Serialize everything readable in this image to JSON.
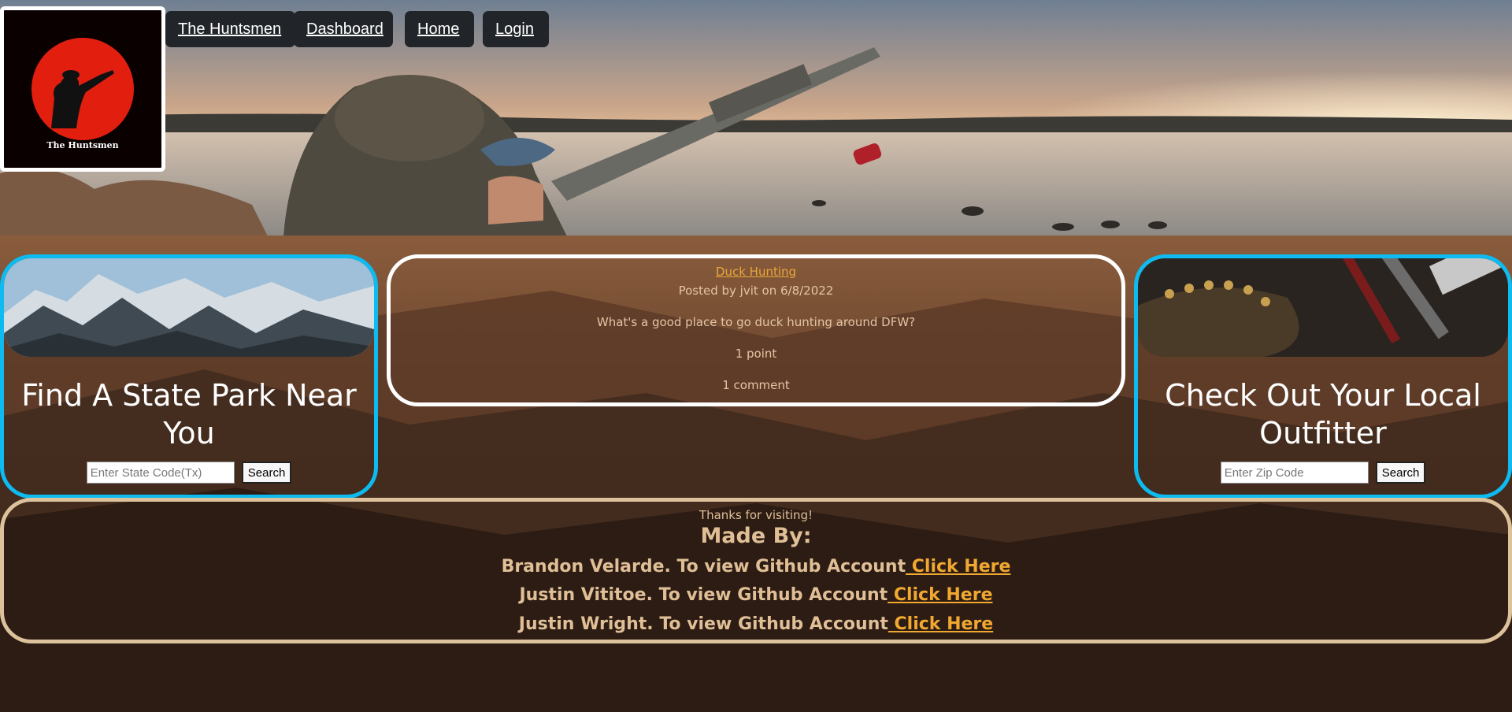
{
  "app": {
    "brand": "The Huntsmen"
  },
  "nav": {
    "items": [
      "The Huntsmen",
      "Dashboard",
      "Home",
      "Login"
    ]
  },
  "left_card": {
    "title": "Find A State Park Near You",
    "input_placeholder": "Enter State Code(Tx)",
    "search_label": "Search"
  },
  "right_card": {
    "title": "Check Out Your Local Outfitter",
    "input_placeholder": "Enter Zip Code",
    "search_label": "Search"
  },
  "post": {
    "title": "Duck Hunting",
    "meta": "Posted by jvit on 6/8/2022",
    "body": "What's a good place to go duck hunting around DFW?",
    "points": "1 point",
    "comments": "1 comment"
  },
  "footer": {
    "thanks": "Thanks for visiting!",
    "made_by": "Made By:",
    "credits": [
      {
        "text": "Brandon Velarde. To view Github Account",
        "link": " Click Here"
      },
      {
        "text": "Justin Vititoe. To view Github Account",
        "link": " Click Here"
      },
      {
        "text": "Justin Wright. To view Github Account",
        "link": " Click Here"
      }
    ]
  },
  "colors": {
    "card_border": "#0dbbf0",
    "link_gold": "#f0a830",
    "footer_border": "#dcc19a"
  }
}
